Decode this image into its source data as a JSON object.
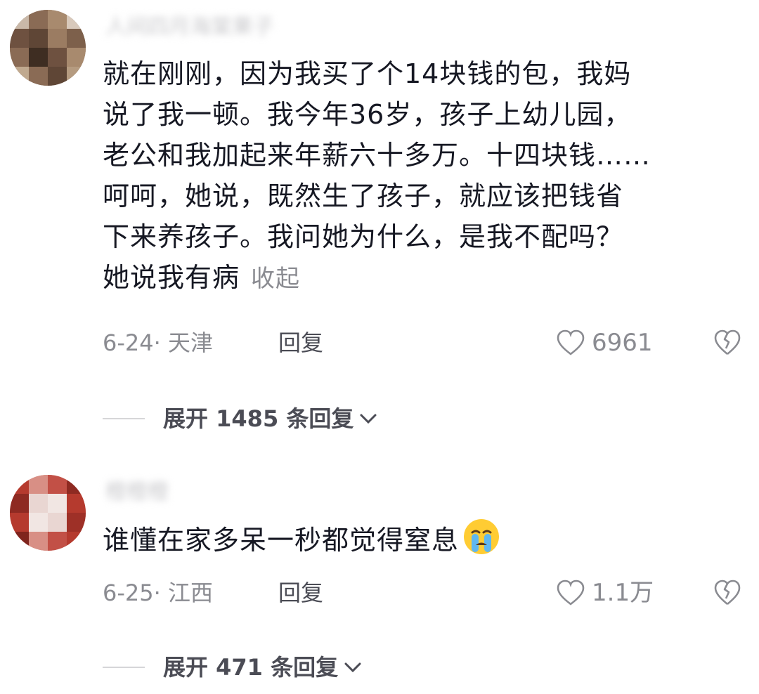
{
  "comments": [
    {
      "username": "人间四月海棠果子",
      "text": [
        "就在刚刚，因为我买了个14块钱的包，我妈",
        "说了我一顿。我今年36岁，孩子上幼儿园，",
        "老公和我加起来年薪六十多万。十四块钱……",
        "呵呵，她说，既然生了孩子，就应该把钱省",
        "下来养孩子。我问她为什么，是我不配吗？",
        "她说我有病"
      ],
      "collapse_label": "收起",
      "date_location": "6-24· 天津",
      "reply_label": "回复",
      "like_count": "6961",
      "expand_label": "展开 1485 条回复",
      "avatar_colors": [
        "#8a6b55",
        "#5f4636",
        "#a88a6e",
        "#3e2d22"
      ]
    },
    {
      "username": "橙橙橙",
      "text": [
        "谁懂在家多呆一秒都觉得窒息"
      ],
      "date_location": "6-25· 江西",
      "reply_label": "回复",
      "like_count": "1.1万",
      "expand_label": "展开 471 条回复",
      "emoji": "crying-face",
      "avatar_colors": [
        "#b53a2e",
        "#e9d6d2",
        "#8e2a22",
        "#f1e6e3"
      ]
    }
  ],
  "colors": {
    "text": "#161823",
    "meta": "#8a8b91",
    "reply": "#4b4c55"
  }
}
